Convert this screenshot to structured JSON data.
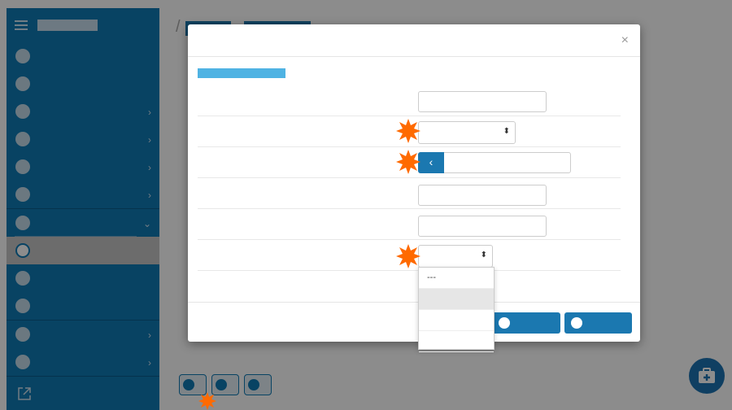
{
  "sidebar": {
    "title": "",
    "items": [
      {
        "label": "",
        "chevron": false
      },
      {
        "label": "",
        "chevron": false
      },
      {
        "label": "",
        "chevron": true
      },
      {
        "label": "",
        "chevron": true
      },
      {
        "label": "",
        "chevron": true
      },
      {
        "label": "",
        "chevron": true
      },
      {
        "label": "",
        "chevron": true,
        "expanded": true
      },
      {
        "label": "",
        "chevron": false,
        "active": true
      },
      {
        "label": "",
        "chevron": false
      },
      {
        "label": "",
        "chevron": false
      },
      {
        "label": "",
        "chevron": true
      },
      {
        "label": "",
        "chevron": true
      }
    ],
    "footer_icon": "external-link-icon"
  },
  "modal": {
    "title": "",
    "section_title": "",
    "close_icon": "close-icon",
    "fields": [
      {
        "label": "",
        "type": "input",
        "value": ""
      },
      {
        "label": "",
        "type": "select",
        "value": ""
      },
      {
        "label": "",
        "type": "date",
        "value": ""
      },
      {
        "label": "",
        "type": "input",
        "value": ""
      },
      {
        "label": "",
        "type": "input",
        "value": ""
      },
      {
        "label": "",
        "type": "select",
        "value": ""
      },
      {
        "label": "",
        "type": "none",
        "value": ""
      }
    ],
    "dropdown_options": [
      "---",
      "",
      "",
      ""
    ],
    "footer_buttons": [
      {
        "label": ""
      },
      {
        "label": ""
      }
    ]
  },
  "bottom_buttons": [
    {
      "label": ""
    },
    {
      "label": ""
    },
    {
      "label": ""
    }
  ],
  "fab_icon": "medical-kit-icon",
  "colors": {
    "accent": "#1b78b0",
    "sidebar": "#0f7ab4",
    "section": "#4fb3e3",
    "burst": "#ff6a00"
  }
}
